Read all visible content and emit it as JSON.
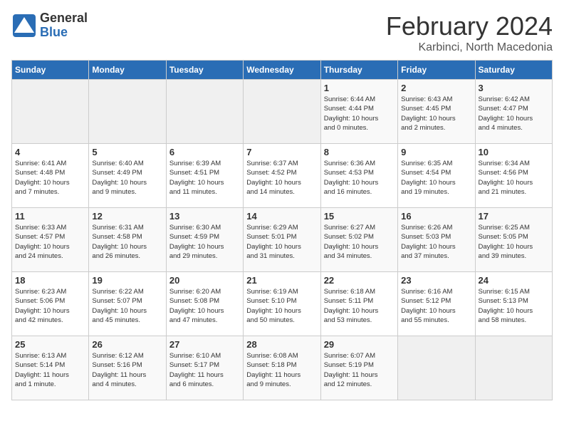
{
  "logo": {
    "general": "General",
    "blue": "Blue"
  },
  "title": "February 2024",
  "subtitle": "Karbinci, North Macedonia",
  "days_of_week": [
    "Sunday",
    "Monday",
    "Tuesday",
    "Wednesday",
    "Thursday",
    "Friday",
    "Saturday"
  ],
  "weeks": [
    [
      {
        "num": "",
        "info": ""
      },
      {
        "num": "",
        "info": ""
      },
      {
        "num": "",
        "info": ""
      },
      {
        "num": "",
        "info": ""
      },
      {
        "num": "1",
        "info": "Sunrise: 6:44 AM\nSunset: 4:44 PM\nDaylight: 10 hours\nand 0 minutes."
      },
      {
        "num": "2",
        "info": "Sunrise: 6:43 AM\nSunset: 4:45 PM\nDaylight: 10 hours\nand 2 minutes."
      },
      {
        "num": "3",
        "info": "Sunrise: 6:42 AM\nSunset: 4:47 PM\nDaylight: 10 hours\nand 4 minutes."
      }
    ],
    [
      {
        "num": "4",
        "info": "Sunrise: 6:41 AM\nSunset: 4:48 PM\nDaylight: 10 hours\nand 7 minutes."
      },
      {
        "num": "5",
        "info": "Sunrise: 6:40 AM\nSunset: 4:49 PM\nDaylight: 10 hours\nand 9 minutes."
      },
      {
        "num": "6",
        "info": "Sunrise: 6:39 AM\nSunset: 4:51 PM\nDaylight: 10 hours\nand 11 minutes."
      },
      {
        "num": "7",
        "info": "Sunrise: 6:37 AM\nSunset: 4:52 PM\nDaylight: 10 hours\nand 14 minutes."
      },
      {
        "num": "8",
        "info": "Sunrise: 6:36 AM\nSunset: 4:53 PM\nDaylight: 10 hours\nand 16 minutes."
      },
      {
        "num": "9",
        "info": "Sunrise: 6:35 AM\nSunset: 4:54 PM\nDaylight: 10 hours\nand 19 minutes."
      },
      {
        "num": "10",
        "info": "Sunrise: 6:34 AM\nSunset: 4:56 PM\nDaylight: 10 hours\nand 21 minutes."
      }
    ],
    [
      {
        "num": "11",
        "info": "Sunrise: 6:33 AM\nSunset: 4:57 PM\nDaylight: 10 hours\nand 24 minutes."
      },
      {
        "num": "12",
        "info": "Sunrise: 6:31 AM\nSunset: 4:58 PM\nDaylight: 10 hours\nand 26 minutes."
      },
      {
        "num": "13",
        "info": "Sunrise: 6:30 AM\nSunset: 4:59 PM\nDaylight: 10 hours\nand 29 minutes."
      },
      {
        "num": "14",
        "info": "Sunrise: 6:29 AM\nSunset: 5:01 PM\nDaylight: 10 hours\nand 31 minutes."
      },
      {
        "num": "15",
        "info": "Sunrise: 6:27 AM\nSunset: 5:02 PM\nDaylight: 10 hours\nand 34 minutes."
      },
      {
        "num": "16",
        "info": "Sunrise: 6:26 AM\nSunset: 5:03 PM\nDaylight: 10 hours\nand 37 minutes."
      },
      {
        "num": "17",
        "info": "Sunrise: 6:25 AM\nSunset: 5:05 PM\nDaylight: 10 hours\nand 39 minutes."
      }
    ],
    [
      {
        "num": "18",
        "info": "Sunrise: 6:23 AM\nSunset: 5:06 PM\nDaylight: 10 hours\nand 42 minutes."
      },
      {
        "num": "19",
        "info": "Sunrise: 6:22 AM\nSunset: 5:07 PM\nDaylight: 10 hours\nand 45 minutes."
      },
      {
        "num": "20",
        "info": "Sunrise: 6:20 AM\nSunset: 5:08 PM\nDaylight: 10 hours\nand 47 minutes."
      },
      {
        "num": "21",
        "info": "Sunrise: 6:19 AM\nSunset: 5:10 PM\nDaylight: 10 hours\nand 50 minutes."
      },
      {
        "num": "22",
        "info": "Sunrise: 6:18 AM\nSunset: 5:11 PM\nDaylight: 10 hours\nand 53 minutes."
      },
      {
        "num": "23",
        "info": "Sunrise: 6:16 AM\nSunset: 5:12 PM\nDaylight: 10 hours\nand 55 minutes."
      },
      {
        "num": "24",
        "info": "Sunrise: 6:15 AM\nSunset: 5:13 PM\nDaylight: 10 hours\nand 58 minutes."
      }
    ],
    [
      {
        "num": "25",
        "info": "Sunrise: 6:13 AM\nSunset: 5:14 PM\nDaylight: 11 hours\nand 1 minute."
      },
      {
        "num": "26",
        "info": "Sunrise: 6:12 AM\nSunset: 5:16 PM\nDaylight: 11 hours\nand 4 minutes."
      },
      {
        "num": "27",
        "info": "Sunrise: 6:10 AM\nSunset: 5:17 PM\nDaylight: 11 hours\nand 6 minutes."
      },
      {
        "num": "28",
        "info": "Sunrise: 6:08 AM\nSunset: 5:18 PM\nDaylight: 11 hours\nand 9 minutes."
      },
      {
        "num": "29",
        "info": "Sunrise: 6:07 AM\nSunset: 5:19 PM\nDaylight: 11 hours\nand 12 minutes."
      },
      {
        "num": "",
        "info": ""
      },
      {
        "num": "",
        "info": ""
      }
    ]
  ]
}
